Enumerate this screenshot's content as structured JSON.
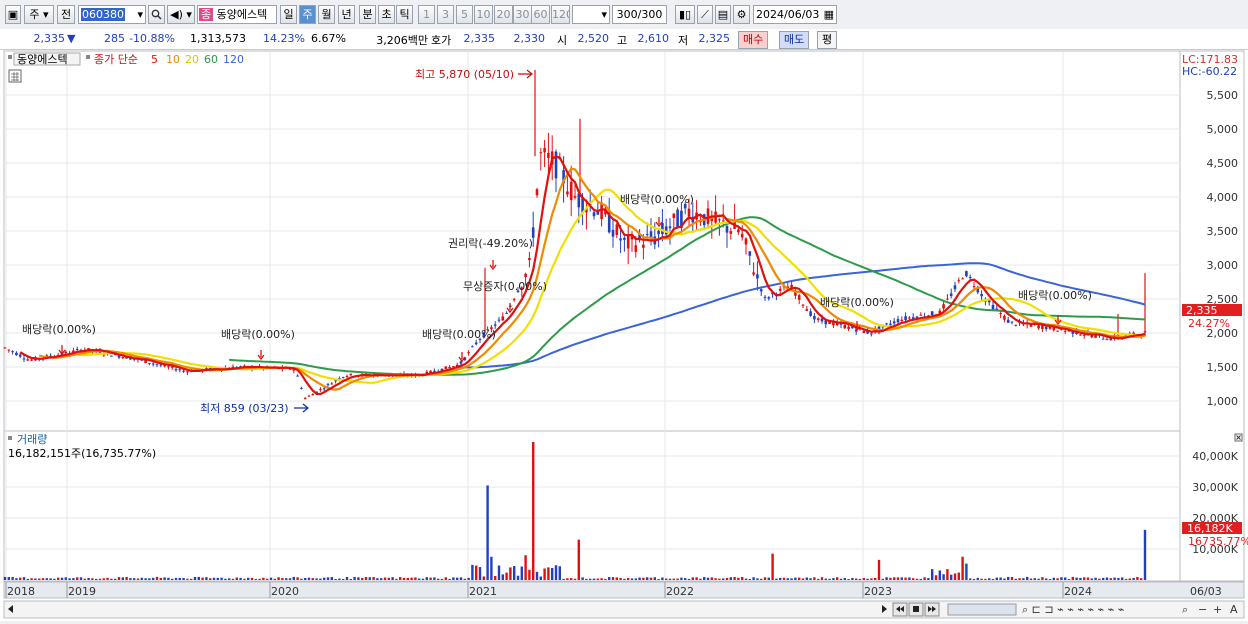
{
  "toolbar": {
    "market_label": "주",
    "prev_label": "전",
    "code": "060380",
    "stock_name": "동양에스텍",
    "name_badge": "종",
    "period_tabs": [
      "일",
      "주",
      "월",
      "년",
      "분",
      "초",
      "틱"
    ],
    "active_period": "주",
    "interval_buttons": [
      "1",
      "3",
      "5",
      "10",
      "20",
      "30",
      "60",
      "120"
    ],
    "count": "300/300",
    "date": "2024/06/03"
  },
  "quote": {
    "price": "2,335",
    "direction_icon": "down-triangle",
    "change": "285",
    "change_pct": "-10.88%",
    "volume": "1,313,573",
    "vol_rate": "14.23%",
    "turnover_pct": "6.67%",
    "amount": "3,206백만",
    "bid_ask_label": "호가",
    "ask": "2,335",
    "bid": "2,330",
    "open_label": "시",
    "open": "2,520",
    "high_label": "고",
    "high": "2,610",
    "low_label": "저",
    "low": "2,325",
    "buy_label": "매수",
    "sell_label": "매도",
    "avg_label": "평"
  },
  "legend": {
    "name": "동양에스텍",
    "price_type": "종가 단순",
    "ma": [
      "5",
      "10",
      "20",
      "60",
      "120"
    ]
  },
  "colors": {
    "up": "#e01010",
    "down": "#2040c0",
    "ma5": "#e01010",
    "ma10": "#f08a00",
    "ma20": "#f0e000",
    "ma60": "#2e9a4a",
    "ma120": "#3a64d8",
    "price_tag": "#e02020"
  },
  "lc": "LC:171.83",
  "hc": "HC:-60.22",
  "y_axis_ticks": [
    "5,500",
    "5,000",
    "4,500",
    "4,000",
    "3,500",
    "3,000",
    "2,500",
    "2,000",
    "1,500",
    "1,000"
  ],
  "current_price_tag": "2,335",
  "current_pct_tag": "24.27%",
  "annotations": {
    "max": "최고 5,870 (05/10)",
    "min": "최저 859 (03/23)",
    "div1": "배당락(0.00%)",
    "div2": "배당락(0.00%)",
    "div3": "배당락(0.00%)",
    "rights": "권리락(-49.20%)",
    "bonus": "무상증자(0.00%)",
    "div4": "배당락(0.00%)",
    "div5": "배당락(0.00%)",
    "div6": "배당락(0.00%)"
  },
  "volume_panel": {
    "title": "거래량",
    "value": "16,182,151주(16,735.77%)",
    "ticks": [
      "40,000K",
      "30,000K",
      "20,000K",
      "10,000K"
    ],
    "vol_tag": "16,182K",
    "vol_tag2": "16735.77%"
  },
  "x_axis": [
    "2018",
    "2019",
    "2020",
    "2021",
    "2022",
    "2023",
    "2024",
    "06/03"
  ]
}
